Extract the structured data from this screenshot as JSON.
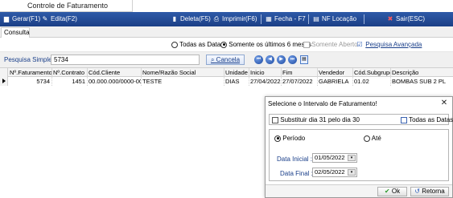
{
  "window": {
    "title": "Controle de Faturamento"
  },
  "toolbar": {
    "gerar": "Gerar(F1)",
    "edita": "Edita(F2)",
    "deleta": "Deleta(F5)",
    "imprimir": "Imprimir(F6)",
    "fecha": "Fecha - F7",
    "nf_locacao": "NF Locação",
    "sair": "Sair(ESC)"
  },
  "subtabs": {
    "consulta": "Consulta"
  },
  "filters": {
    "todas_datas": "Todas as Datas",
    "ultimos_6_meses": "Somente os últimos 6 meses",
    "somente_aberto": "Somente Aberto",
    "pesquisa_avancada": "Pesquisa Avançada"
  },
  "search": {
    "label": "Pesquisa Simples :",
    "value": "5734",
    "cancel": "Cancela"
  },
  "grid": {
    "columns": [
      "Nº.Faturamento",
      "Nº.Contrato",
      "Cód.Cliente",
      "Nome/Razão Social",
      "Unidade",
      "Inicio",
      "Fim",
      "Vendedor",
      "Cód.Subgrupo",
      "Descrição"
    ],
    "rows": [
      [
        "5734",
        "1451",
        "00.000.000/0000-00",
        "TESTE",
        "DIAS",
        "27/04/2022",
        "27/07/2022",
        "GABRIELA",
        "01.02",
        "BOMBAS SUB 2 PL"
      ]
    ]
  },
  "dialog": {
    "title": "Selecione o Intervalo de Faturamento!",
    "close": "✕",
    "substituir": "Substituir dia 31 pelo dia 30",
    "todas_datas": "Todas as Datas",
    "periodo": "Período",
    "ate": "Até",
    "data_inicial_label": "Data Inicial :",
    "data_inicial": "01/05/2022",
    "data_final_label": "Data Final :",
    "data_final": "02/05/2022",
    "ok": "Ok",
    "retorna": "Retorna"
  },
  "colors": {
    "toolbar": "#1f4690",
    "accent": "#1a3f8a"
  }
}
